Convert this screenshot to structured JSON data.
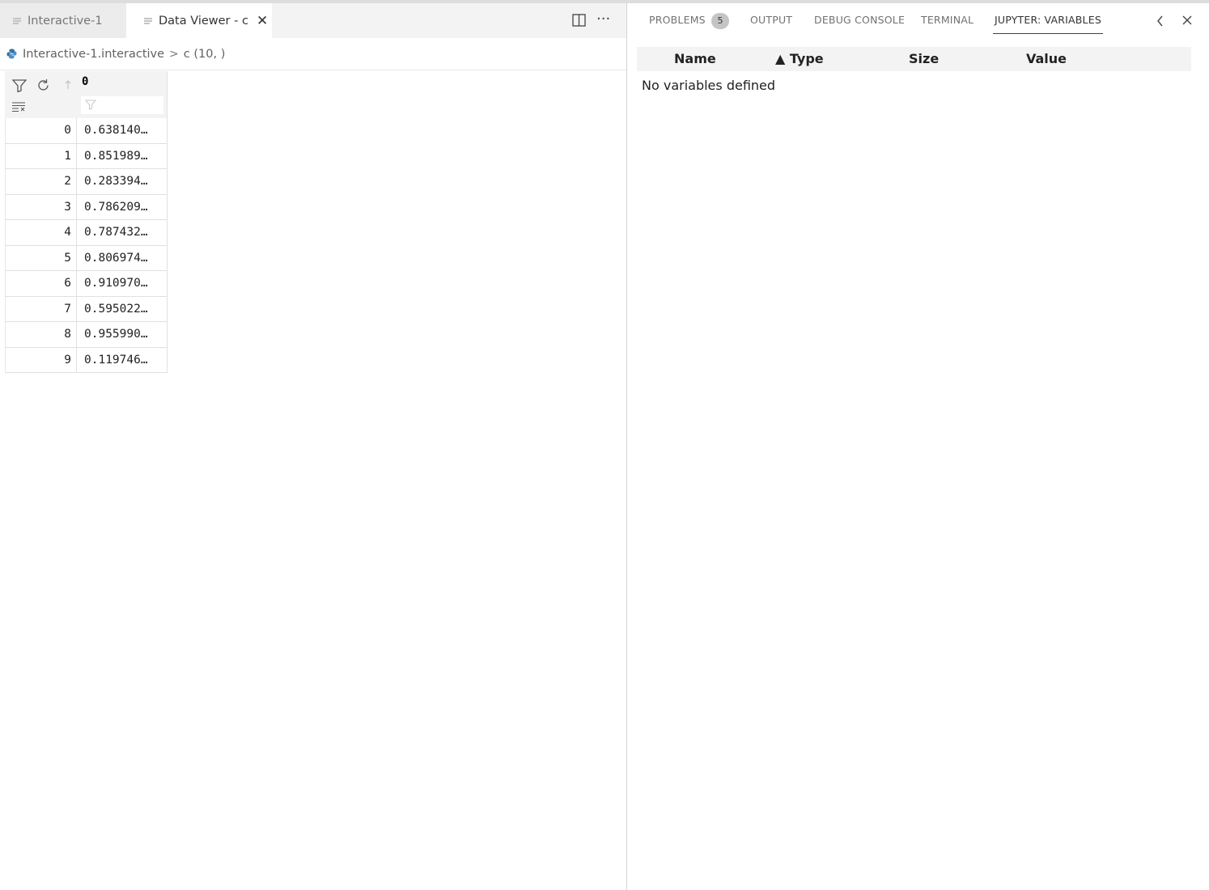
{
  "editor": {
    "tabs": [
      {
        "label": "Interactive-1",
        "icon": "lines-icon",
        "active": false
      },
      {
        "label": "Data Viewer - c",
        "icon": "lines-icon",
        "active": true,
        "close": "✕"
      }
    ],
    "toolbar": {
      "split_icon": "split-editor-icon",
      "more_icon": "···"
    },
    "breadcrumb": {
      "file": "Interactive-1.interactive",
      "separator": ">",
      "symbol": "c (10, )"
    }
  },
  "grid": {
    "column": "0",
    "rows": [
      {
        "index": "0",
        "value": "0.638140…"
      },
      {
        "index": "1",
        "value": "0.851989…"
      },
      {
        "index": "2",
        "value": "0.283394…"
      },
      {
        "index": "3",
        "value": "0.786209…"
      },
      {
        "index": "4",
        "value": "0.787432…"
      },
      {
        "index": "5",
        "value": "0.806974…"
      },
      {
        "index": "6",
        "value": "0.910970…"
      },
      {
        "index": "7",
        "value": "0.595022…"
      },
      {
        "index": "8",
        "value": "0.955990…"
      },
      {
        "index": "9",
        "value": "0.119746…"
      }
    ]
  },
  "panel": {
    "tabs": {
      "problems": "PROBLEMS",
      "problems_count": "5",
      "output": "OUTPUT",
      "debug": "DEBUG CONSOLE",
      "terminal": "TERMINAL",
      "variables": "JUPYTER: VARIABLES"
    },
    "table": {
      "headers": {
        "name": "Name",
        "type": "▲ Type",
        "size": "Size",
        "value": "Value"
      },
      "empty_message": "No variables defined"
    }
  },
  "colors": {
    "accent": "#424242",
    "badge": "#c4c4c4",
    "python_icon": "#3572A5"
  }
}
